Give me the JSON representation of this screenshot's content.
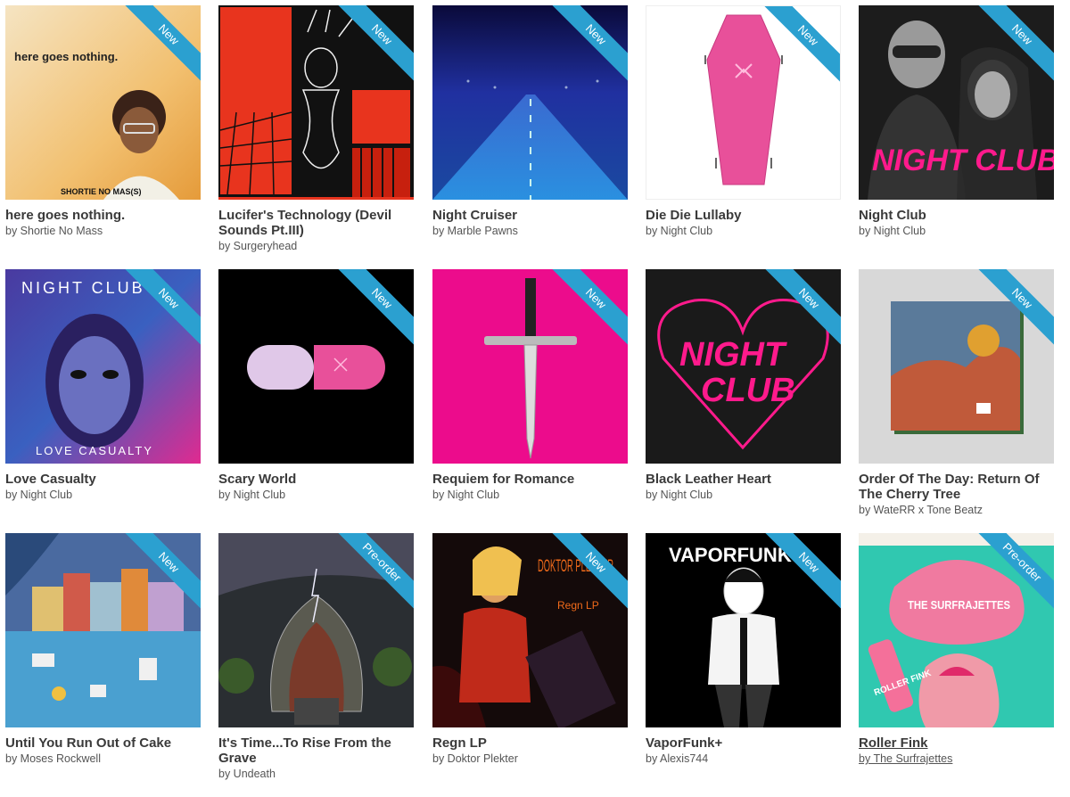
{
  "ribbons": {
    "new": "New",
    "preorder": "Pre-order"
  },
  "albums": [
    {
      "title": "here goes nothing.",
      "artist": "by Shortie No Mass",
      "ribbon": "New",
      "cover_text": "here goes nothing.",
      "cover_sub": "SHORTIE NO MAS(S)"
    },
    {
      "title": "Lucifer's Technology (Devil Sounds Pt.III)",
      "artist": "by Surgeryhead",
      "ribbon": "New"
    },
    {
      "title": "Night Cruiser",
      "artist": "by Marble Pawns",
      "ribbon": "New"
    },
    {
      "title": "Die Die Lullaby",
      "artist": "by Night Club",
      "ribbon": "New"
    },
    {
      "title": "Night Club",
      "artist": "by Night Club",
      "ribbon": "New",
      "cover_text": "NIGHT CLUB"
    },
    {
      "title": "Love Casualty",
      "artist": "by Night Club",
      "ribbon": "New",
      "cover_text": "NIGHT CLUB",
      "cover_sub": "LOVE CASUALTY"
    },
    {
      "title": "Scary World",
      "artist": "by Night Club",
      "ribbon": "New"
    },
    {
      "title": "Requiem for Romance",
      "artist": "by Night Club",
      "ribbon": "New"
    },
    {
      "title": "Black Leather Heart",
      "artist": "by Night Club",
      "ribbon": "New",
      "cover_text": "NIGHT",
      "cover_sub": "CLUB"
    },
    {
      "title": "Order Of The Day: Return Of The Cherry Tree",
      "artist": "by WateRR x Tone Beatz",
      "ribbon": "New"
    },
    {
      "title": "Until You Run Out of Cake",
      "artist": "by Moses Rockwell",
      "ribbon": "New"
    },
    {
      "title": "It's Time...To Rise From the Grave",
      "artist": "by Undeath",
      "ribbon": "Pre-order"
    },
    {
      "title": "Regn LP",
      "artist": "by Doktor Plekter",
      "ribbon": "New",
      "cover_text": "DOKTOR PLEKTER",
      "cover_sub": "Regn LP"
    },
    {
      "title": "VaporFunk+",
      "artist": "by Alexis744",
      "ribbon": "New",
      "cover_text": "VAPORFUNK"
    },
    {
      "title": "Roller Fink",
      "artist": "by The Surfrajettes",
      "ribbon": "Pre-order",
      "cover_text": "THE SURFRAJETTES",
      "cover_sub": "ROLLER FINK"
    }
  ],
  "colors": {
    "ribbon": "#2ba0d0",
    "title": "#3a3a3a",
    "artist": "#555555"
  }
}
